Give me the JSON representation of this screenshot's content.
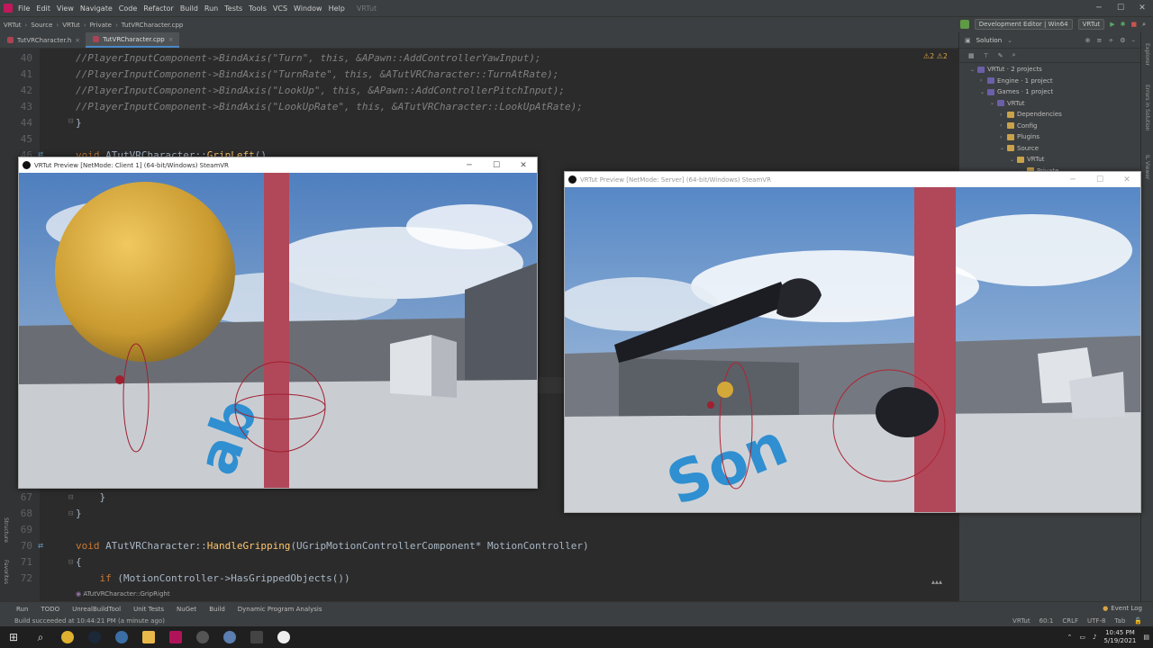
{
  "menubar": {
    "items": [
      "File",
      "Edit",
      "View",
      "Navigate",
      "Code",
      "Refactor",
      "Build",
      "Run",
      "Tests",
      "Tools",
      "VCS",
      "Window",
      "Help"
    ],
    "project_name": "VRTut"
  },
  "navbar": {
    "crumbs": [
      "VRTut",
      "Source",
      "VRTut",
      "Private",
      "TutVRCharacter.cpp"
    ],
    "config": "Development Editor | Win64",
    "target": "VRTut"
  },
  "tabs": [
    {
      "label": "TutVRCharacter.h"
    },
    {
      "label": "TutVRCharacter.cpp"
    }
  ],
  "warnings": {
    "warn_count": "2",
    "weak_count": "2"
  },
  "code_top": [
    {
      "n": "40",
      "text": "//PlayerInputComponent->BindAxis(\"Turn\", this, &APawn::AddControllerYawInput);"
    },
    {
      "n": "41",
      "text": "//PlayerInputComponent->BindAxis(\"TurnRate\", this, &ATutVRCharacter::TurnAtRate);"
    },
    {
      "n": "42",
      "text": "//PlayerInputComponent->BindAxis(\"LookUp\", this, &APawn::AddControllerPitchInput);"
    },
    {
      "n": "43",
      "text": "//PlayerInputComponent->BindAxis(\"LookUpRate\", this, &ATutVRCharacter::LookUpAtRate);"
    },
    {
      "n": "44",
      "text": "}"
    },
    {
      "n": "45",
      "text": ""
    },
    {
      "n": "46",
      "text": "void ATutVRCharacter::GripLeft()"
    }
  ],
  "code_bottom": [
    {
      "n": "67",
      "text": "    }"
    },
    {
      "n": "68",
      "text": "}"
    },
    {
      "n": "69",
      "text": ""
    },
    {
      "n": "70",
      "text": "void ATutVRCharacter::HandleGripping(UGripMotionControllerComponent* MotionController)"
    },
    {
      "n": "71",
      "text": "{"
    },
    {
      "n": "72",
      "text": "    if (MotionController->HasGrippedObjects())"
    }
  ],
  "breadcrumb_function": "ATutVRCharacter::GripRight",
  "solution": {
    "header": "Solution",
    "tree": [
      {
        "label": "VRTut · 2 projects",
        "depth": 0,
        "expanded": true
      },
      {
        "label": "Engine · 1 project",
        "depth": 1,
        "expanded": false
      },
      {
        "label": "Games · 1 project",
        "depth": 1,
        "expanded": true
      },
      {
        "label": "VRTut",
        "depth": 2,
        "expanded": true
      },
      {
        "label": "Dependencies",
        "depth": 3,
        "expanded": false
      },
      {
        "label": "Config",
        "depth": 3,
        "expanded": false
      },
      {
        "label": "Plugins",
        "depth": 3,
        "expanded": false
      },
      {
        "label": "Source",
        "depth": 3,
        "expanded": true
      },
      {
        "label": "VRTut",
        "depth": 4,
        "expanded": true
      },
      {
        "label": "Private",
        "depth": 5,
        "expanded": true
      }
    ]
  },
  "side_labels": [
    "Explorer",
    "Errors in Solution",
    "IL Viewer"
  ],
  "left_side_labels": [
    "Structure",
    "Favorites"
  ],
  "preview_client": {
    "title": "VRTut Preview [NetMode: Client 1]  (64-bit/Windows) SteamVR"
  },
  "preview_server": {
    "title": "VRTut Preview [NetMode: Server]  (64-bit/Windows) SteamVR"
  },
  "toolwindows": [
    "Run",
    "TODO",
    "UnrealBuildTool",
    "Unit Tests",
    "NuGet",
    "Build",
    "Dynamic Program Analysis"
  ],
  "event_log": "Event Log",
  "status": {
    "message": "Build succeeded at 10:44:21 PM (a minute ago)",
    "project": "VRTut",
    "position": "60:1",
    "line_ending": "CRLF",
    "encoding": "UTF-8",
    "indent": "Tab"
  },
  "clock": {
    "time": "10:45 PM",
    "date": "5/19/2021"
  },
  "colors": {
    "accent": "#4a88c7",
    "comment": "#808080",
    "keyword": "#cc7832"
  }
}
